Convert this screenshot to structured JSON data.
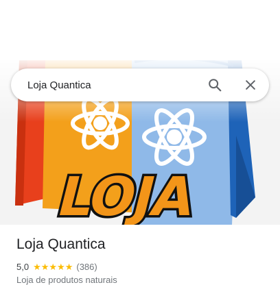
{
  "search": {
    "query": "Loja Quantica"
  },
  "hero": {
    "logo_text": "LOJA"
  },
  "place": {
    "name": "Loja Quantica",
    "rating": "5,0",
    "stars": 5,
    "reviews": "(386)",
    "category": "Loja de produtos naturais"
  },
  "icons": {
    "search": "search-icon",
    "close": "close-icon",
    "star": "star-icon"
  },
  "colors": {
    "star": "#fbbc04",
    "bag_orange": "#f3a01b",
    "bag_red": "#e8401c",
    "bag_light_blue": "#8fb9e8",
    "bag_dark_blue": "#1e63b8",
    "logo_fill": "#f39519"
  }
}
